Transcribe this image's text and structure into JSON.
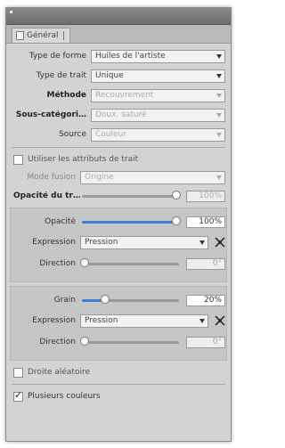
{
  "panel": {
    "tab_label": "Général"
  },
  "rows": {
    "brush_type": {
      "label": "Type de forme",
      "value": "Huiles de l'artiste"
    },
    "stroke_type": {
      "label": "Type de trait",
      "value": "Unique"
    },
    "method": {
      "label": "Méthode",
      "value": "Recouvrement"
    },
    "subcategory": {
      "label": "Sous-catégori…",
      "value": "Doux, saturé"
    },
    "source": {
      "label": "Source",
      "value": "Couleur"
    }
  },
  "stroke_attr": {
    "label": "Utiliser les attributs de trait"
  },
  "fusion_mode": {
    "label": "Mode fusion",
    "value": "Origine"
  },
  "stroke_opacity": {
    "label": "Opacité du tr…",
    "value": "100%",
    "fraction": 1.0
  },
  "opacity": {
    "label": "Opacité",
    "value": "100%",
    "fraction": 1.0
  },
  "opacity_expression": {
    "label": "Expression",
    "value": "Pression"
  },
  "opacity_direction": {
    "label": "Direction",
    "value": "0°",
    "fraction": 0.0
  },
  "grain": {
    "label": "Grain",
    "value": "20%",
    "fraction": 0.2
  },
  "grain_expression": {
    "label": "Expression",
    "value": "Pression"
  },
  "grain_direction": {
    "label": "Direction",
    "value": "0°",
    "fraction": 0.0
  },
  "checks": {
    "straight_line": {
      "label": "Droite aléatoire",
      "checked": false
    },
    "multi_color": {
      "label": "Plusieurs couleurs",
      "checked": true
    }
  },
  "colors": {
    "accent": "#3f7fd1",
    "panel_bg": "#d3d3d3"
  }
}
